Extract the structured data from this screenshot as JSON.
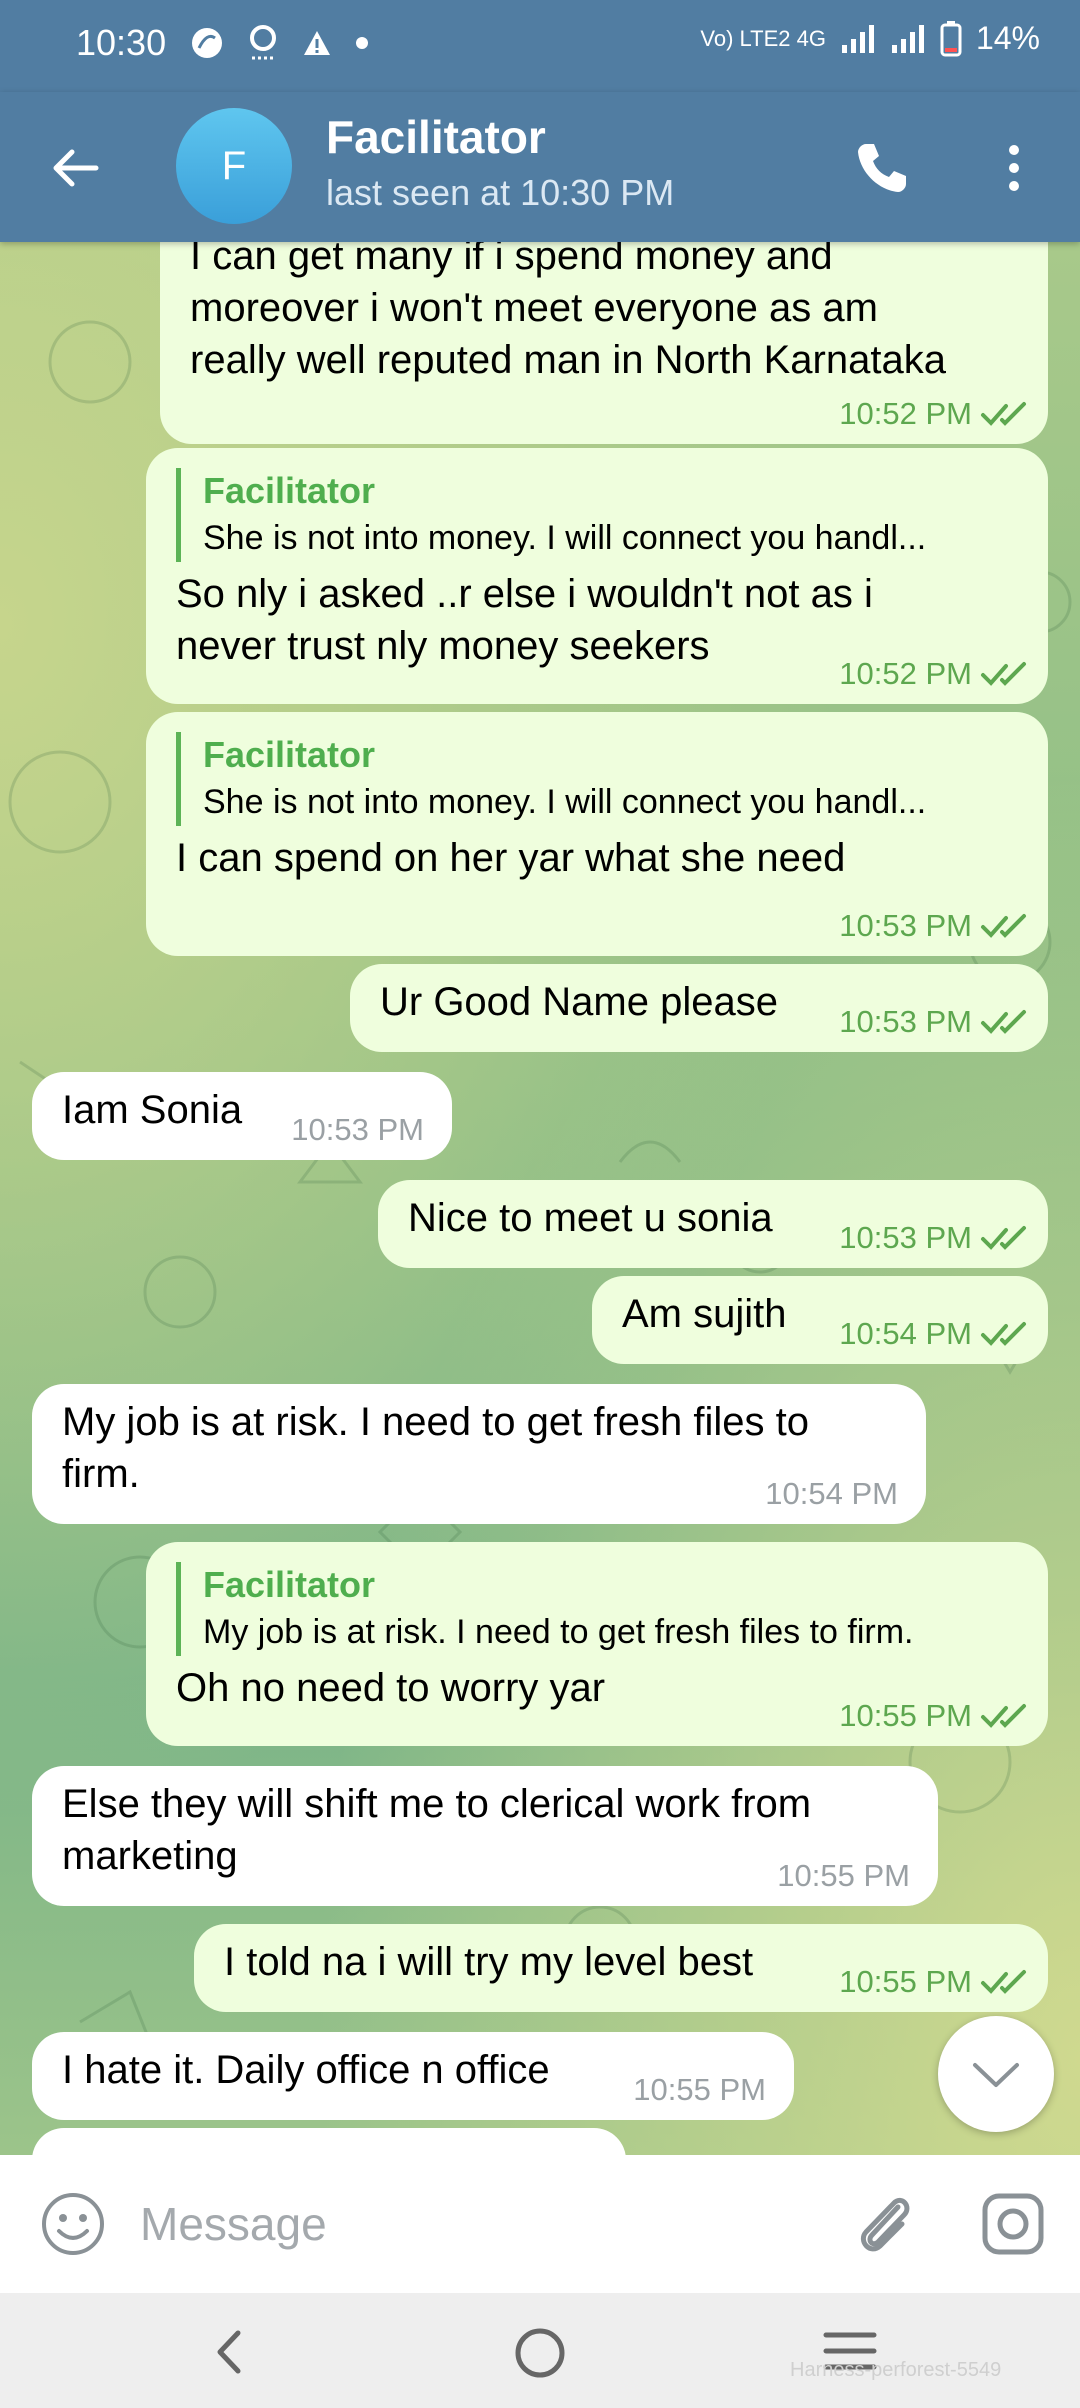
{
  "status_bar": {
    "time": "10:30",
    "network": "Vo) LTE2 4G",
    "battery": "14%"
  },
  "header": {
    "avatar_letter": "F",
    "title": "Facilitator",
    "subtitle": "last seen at 10:30 PM"
  },
  "messages": [
    {
      "dir": "out",
      "text": "I can get many if i spend money and\nmoreover i won't meet everyone as am\nreally well reputed man in North Karnataka",
      "time": "10:52 PM"
    },
    {
      "dir": "out",
      "reply_name": "Facilitator",
      "reply_text": "She is not into money. I will connect you handl...",
      "text": "So nly i asked ..r else i wouldn't not as i\nnever trust nly money seekers",
      "time": "10:52 PM"
    },
    {
      "dir": "out",
      "reply_name": "Facilitator",
      "reply_text": "She is not into money. I will connect you handl...",
      "text": "I can spend on her yar what she need",
      "time": "10:53 PM"
    },
    {
      "dir": "out",
      "text": "Ur Good Name please",
      "time": "10:53 PM"
    },
    {
      "dir": "in",
      "text": "Iam Sonia",
      "time": "10:53 PM"
    },
    {
      "dir": "out",
      "text": "Nice to meet u sonia",
      "time": "10:53 PM"
    },
    {
      "dir": "out",
      "text": "Am sujith",
      "time": "10:54 PM"
    },
    {
      "dir": "in",
      "text": "My job is at risk. I need to get fresh files to\nfirm.",
      "time": "10:54 PM"
    },
    {
      "dir": "out",
      "reply_name": "Facilitator",
      "reply_text": "My job is at risk. I need to get fresh files to firm.",
      "text": "Oh no need to worry yar",
      "time": "10:55 PM"
    },
    {
      "dir": "in",
      "text": "Else they will shift me to clerical work from\nmarketing",
      "time": "10:55 PM"
    },
    {
      "dir": "out",
      "text": "I told na i will try my level best",
      "time": "10:55 PM"
    },
    {
      "dir": "in",
      "text": "I hate it. Daily office n office",
      "time": "10:55 PM"
    }
  ],
  "input": {
    "placeholder": "Message"
  },
  "nav": {
    "watermark": "Harness-perforest-5549"
  },
  "colors": {
    "header": "#517da2",
    "outgoing_bubble": "#effedd",
    "incoming_bubble": "#ffffff",
    "accent_green": "#4fae4e"
  }
}
